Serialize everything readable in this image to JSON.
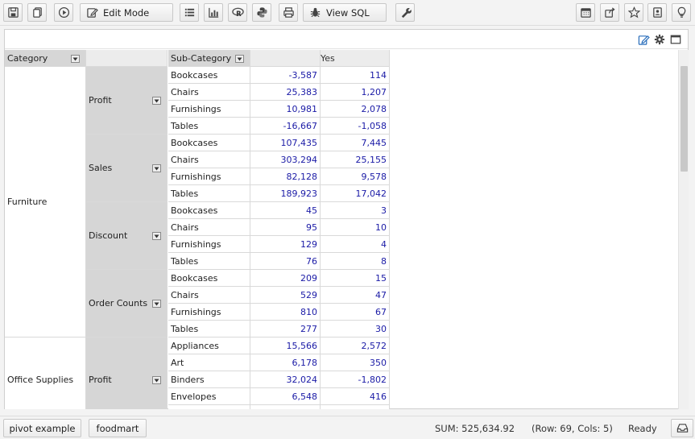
{
  "toolbar": {
    "edit_mode_label": "Edit Mode",
    "view_sql_label": "View SQL",
    "icons": [
      "save-icon",
      "copy-icon",
      "play-icon",
      "edit-icon",
      "list-icon",
      "bar-chart-icon",
      "r-icon",
      "python-icon",
      "print-icon",
      "bug-icon",
      "wrench-icon",
      "calendar-icon",
      "share-icon",
      "star-icon",
      "contact-icon",
      "lightbulb-icon"
    ]
  },
  "panel": {
    "icons": [
      "edit-icon",
      "gear-icon",
      "maximize-icon"
    ]
  },
  "pivot": {
    "headers": {
      "category": "Category",
      "sub_category": "Sub-Category",
      "yes": "Yes"
    },
    "groups": [
      {
        "category": "Furniture",
        "measures": [
          {
            "name": "Profit",
            "rows": [
              {
                "sub": "Bookcases",
                "v1": "-3,587",
                "v2": "114"
              },
              {
                "sub": "Chairs",
                "v1": "25,383",
                "v2": "1,207"
              },
              {
                "sub": "Furnishings",
                "v1": "10,981",
                "v2": "2,078"
              },
              {
                "sub": "Tables",
                "v1": "-16,667",
                "v2": "-1,058"
              }
            ]
          },
          {
            "name": "Sales",
            "rows": [
              {
                "sub": "Bookcases",
                "v1": "107,435",
                "v2": "7,445"
              },
              {
                "sub": "Chairs",
                "v1": "303,294",
                "v2": "25,155"
              },
              {
                "sub": "Furnishings",
                "v1": "82,128",
                "v2": "9,578"
              },
              {
                "sub": "Tables",
                "v1": "189,923",
                "v2": "17,042"
              }
            ]
          },
          {
            "name": "Discount",
            "rows": [
              {
                "sub": "Bookcases",
                "v1": "45",
                "v2": "3"
              },
              {
                "sub": "Chairs",
                "v1": "95",
                "v2": "10"
              },
              {
                "sub": "Furnishings",
                "v1": "129",
                "v2": "4"
              },
              {
                "sub": "Tables",
                "v1": "76",
                "v2": "8"
              }
            ]
          },
          {
            "name": "Order Counts",
            "rows": [
              {
                "sub": "Bookcases",
                "v1": "209",
                "v2": "15"
              },
              {
                "sub": "Chairs",
                "v1": "529",
                "v2": "47"
              },
              {
                "sub": "Furnishings",
                "v1": "810",
                "v2": "67"
              },
              {
                "sub": "Tables",
                "v1": "277",
                "v2": "30"
              }
            ]
          }
        ]
      },
      {
        "category": "Office Supplies",
        "measures": [
          {
            "name": "Profit",
            "rows": [
              {
                "sub": "Appliances",
                "v1": "15,566",
                "v2": "2,572"
              },
              {
                "sub": "Art",
                "v1": "6,178",
                "v2": "350"
              },
              {
                "sub": "Binders",
                "v1": "32,024",
                "v2": "-1,802"
              },
              {
                "sub": "Envelopes",
                "v1": "6,548",
                "v2": "416"
              },
              {
                "sub": "",
                "v1": "",
                "v2": ""
              }
            ]
          }
        ]
      }
    ]
  },
  "statusbar": {
    "tabs": [
      "pivot example",
      "foodmart"
    ],
    "sum": "SUM: 525,634.92",
    "dims": "(Row: 69, Cols: 5)",
    "status": "Ready",
    "right_icon": "tray-icon"
  }
}
